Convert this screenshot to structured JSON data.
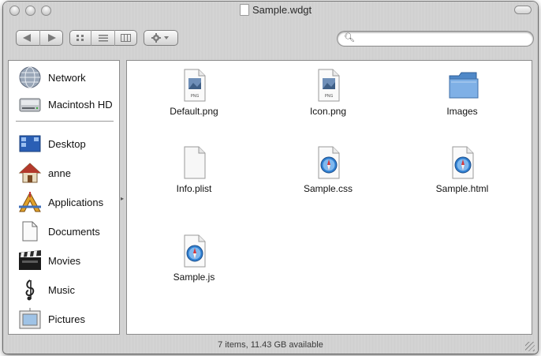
{
  "window": {
    "title": "Sample.wdgt"
  },
  "toolbar": {
    "back_icon": "back-arrow-icon",
    "forward_icon": "forward-arrow-icon",
    "view_icons": [
      "icon-view-icon",
      "list-view-icon",
      "column-view-icon"
    ],
    "action_icon": "gear-icon",
    "search": {
      "value": "",
      "placeholder": ""
    }
  },
  "sidebar": {
    "items": [
      {
        "label": "Network",
        "icon": "network-globe-icon"
      },
      {
        "label": "Macintosh HD",
        "icon": "hard-drive-icon"
      },
      {
        "label": "Desktop",
        "icon": "desktop-icon"
      },
      {
        "label": "anne",
        "icon": "home-icon"
      },
      {
        "label": "Applications",
        "icon": "applications-icon"
      },
      {
        "label": "Documents",
        "icon": "documents-folder-icon"
      },
      {
        "label": "Movies",
        "icon": "movies-clapboard-icon"
      },
      {
        "label": "Music",
        "icon": "music-note-icon"
      },
      {
        "label": "Pictures",
        "icon": "pictures-icon"
      }
    ]
  },
  "files": [
    {
      "name": "Default.png",
      "icon": "png-file-icon",
      "badge": "PNG"
    },
    {
      "name": "Icon.png",
      "icon": "png-file-icon",
      "badge": "PNG"
    },
    {
      "name": "Images",
      "icon": "folder-icon"
    },
    {
      "name": "Info.plist",
      "icon": "generic-file-icon"
    },
    {
      "name": "Sample.css",
      "icon": "safari-document-icon"
    },
    {
      "name": "Sample.html",
      "icon": "safari-document-icon"
    },
    {
      "name": "Sample.js",
      "icon": "safari-document-icon"
    }
  ],
  "status": {
    "text": "7 items, 11.43 GB available"
  },
  "colors": {
    "folder_blue": "#6aa0d8",
    "safari_blue": "#2f7fd1"
  }
}
